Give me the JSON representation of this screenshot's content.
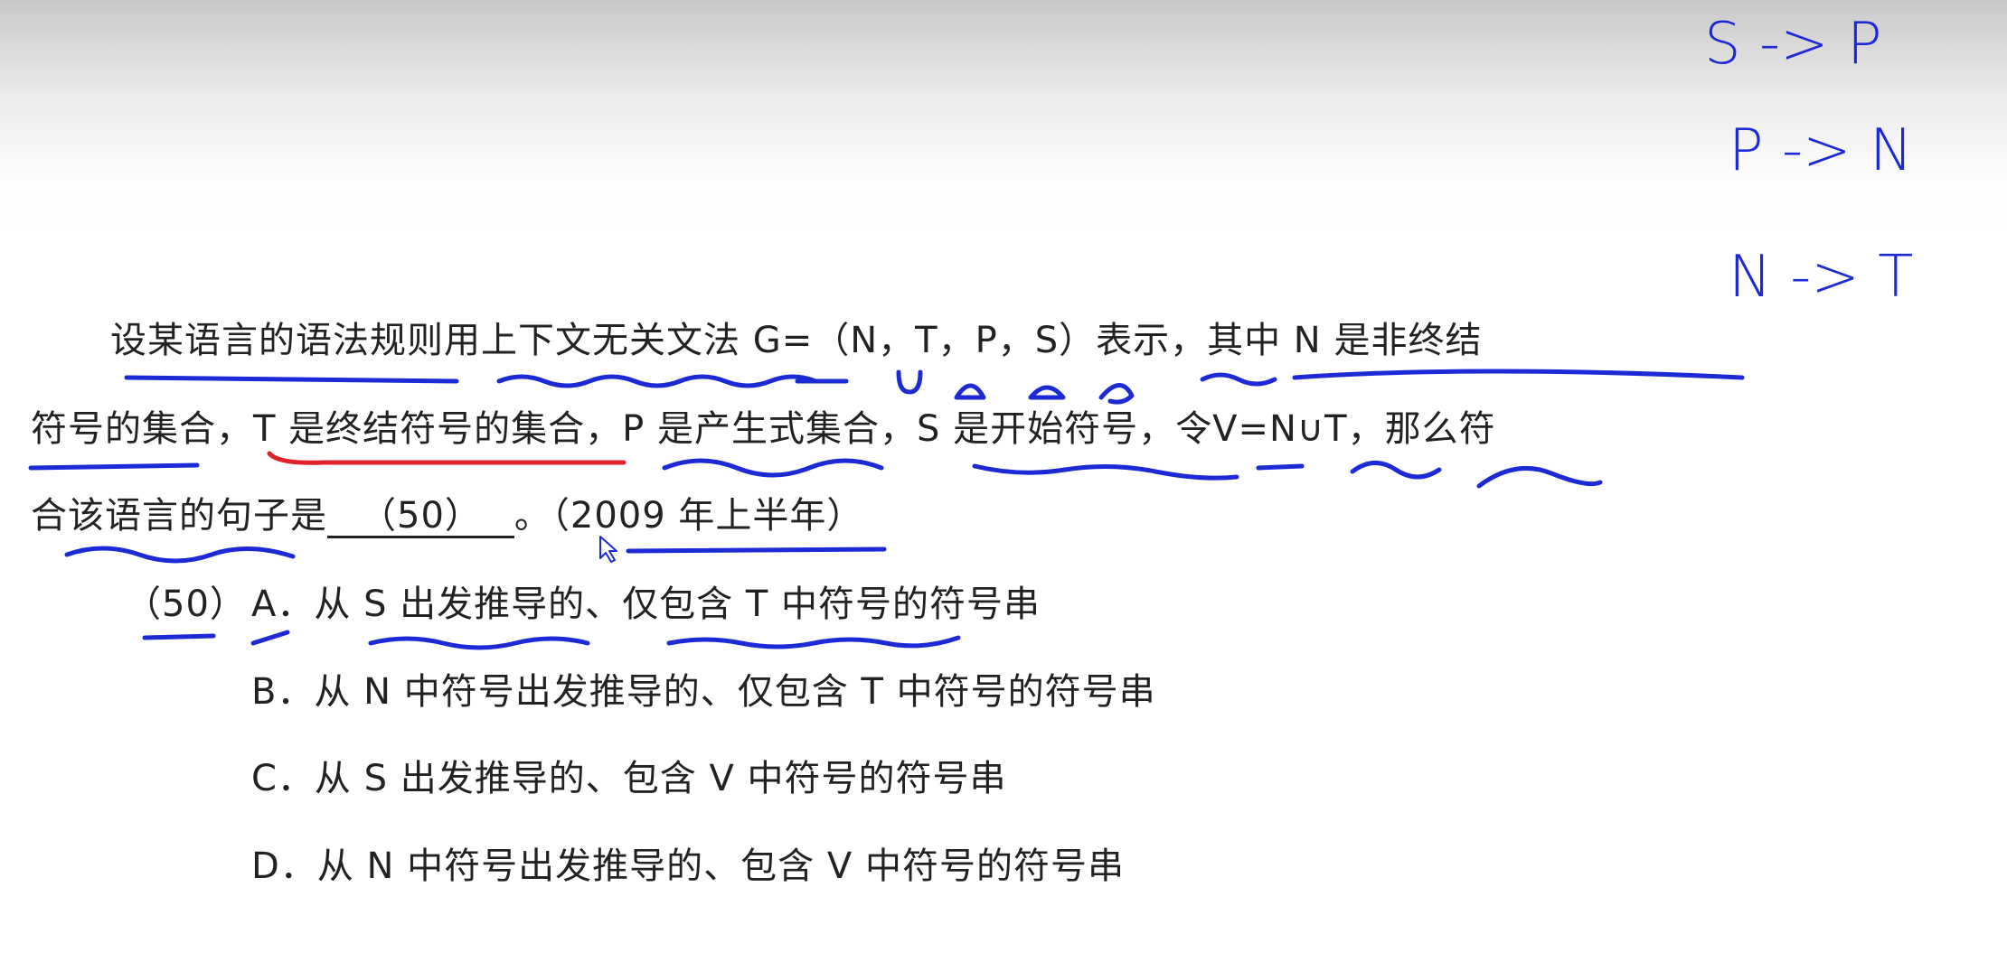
{
  "question": {
    "line1": "设某语言的语法规则用上下文无关文法 G=（N，T，P，S）表示，其中 N 是非终结",
    "line2": "符号的集合，T 是终结符号的集合，P 是产生式集合，S 是开始符号，令V=N∪T，那么符",
    "line3_prefix": "合该语言的句子是",
    "blank": "（50）",
    "line3_suffix": "。（2009 年上半年）"
  },
  "options": {
    "number": "（50）",
    "a": "A．从 S 出发推导的、仅包含 T 中符号的符号串",
    "b": "B．从 N 中符号出发推导的、仅包含 T 中符号的符号串",
    "c": "C．从 S 出发推导的、包含 V 中符号的符号串",
    "d": "D．从 N 中符号出发推导的、包含 V 中符号的符号串"
  },
  "handwriting": {
    "rule1": "S -> P",
    "rule2": "P -> N",
    "rule3": "N -> T"
  },
  "colors": {
    "ink_blue": "#1c2ad6",
    "ink_red": "#e0202a",
    "text": "#222222"
  }
}
